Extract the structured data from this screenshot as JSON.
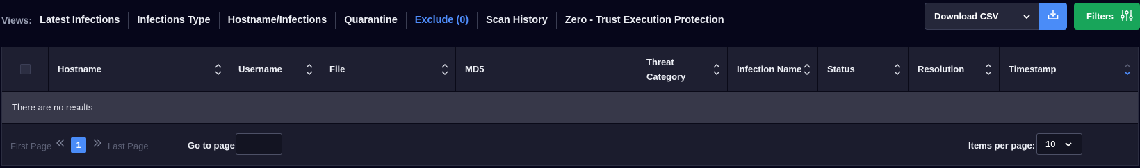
{
  "views": {
    "label": "Views:",
    "tabs": [
      {
        "label": "Latest Infections",
        "active": false
      },
      {
        "label": "Infections Type",
        "active": false
      },
      {
        "label": "Hostname/Infections",
        "active": false
      },
      {
        "label": "Quarantine",
        "active": false
      },
      {
        "label": "Exclude (0)",
        "active": true
      },
      {
        "label": "Scan History",
        "active": false
      },
      {
        "label": "Zero - Trust Execution Protection",
        "active": false
      }
    ]
  },
  "toolbar": {
    "csv_select_label": "Download CSV",
    "csv_download_icon": "download-icon",
    "filters_label": "Filters",
    "filters_icon": "sliders-icon"
  },
  "table": {
    "columns": [
      {
        "label": "Hostname",
        "sort": "none"
      },
      {
        "label": "Username",
        "sort": "none"
      },
      {
        "label": "File",
        "sort": "none"
      },
      {
        "label": "MD5",
        "sort": "none"
      },
      {
        "label": "Threat Category",
        "sort": "none"
      },
      {
        "label": "Infection Name",
        "sort": "none"
      },
      {
        "label": "Status",
        "sort": "none"
      },
      {
        "label": "Resolution",
        "sort": "none"
      },
      {
        "label": "Timestamp",
        "sort": "desc"
      }
    ],
    "empty_message": "There are no results"
  },
  "pagination": {
    "first_label": "First Page",
    "last_label": "Last Page",
    "current_page": "1",
    "goto_label": "Go to page:",
    "goto_value": "",
    "items_per_page_label": "Items per page:",
    "items_per_page_value": "10"
  },
  "colors": {
    "background": "#06061a",
    "accent_blue": "#4a8cf8",
    "filters_green": "#18a55a",
    "active_tab": "#4f8dfb"
  }
}
